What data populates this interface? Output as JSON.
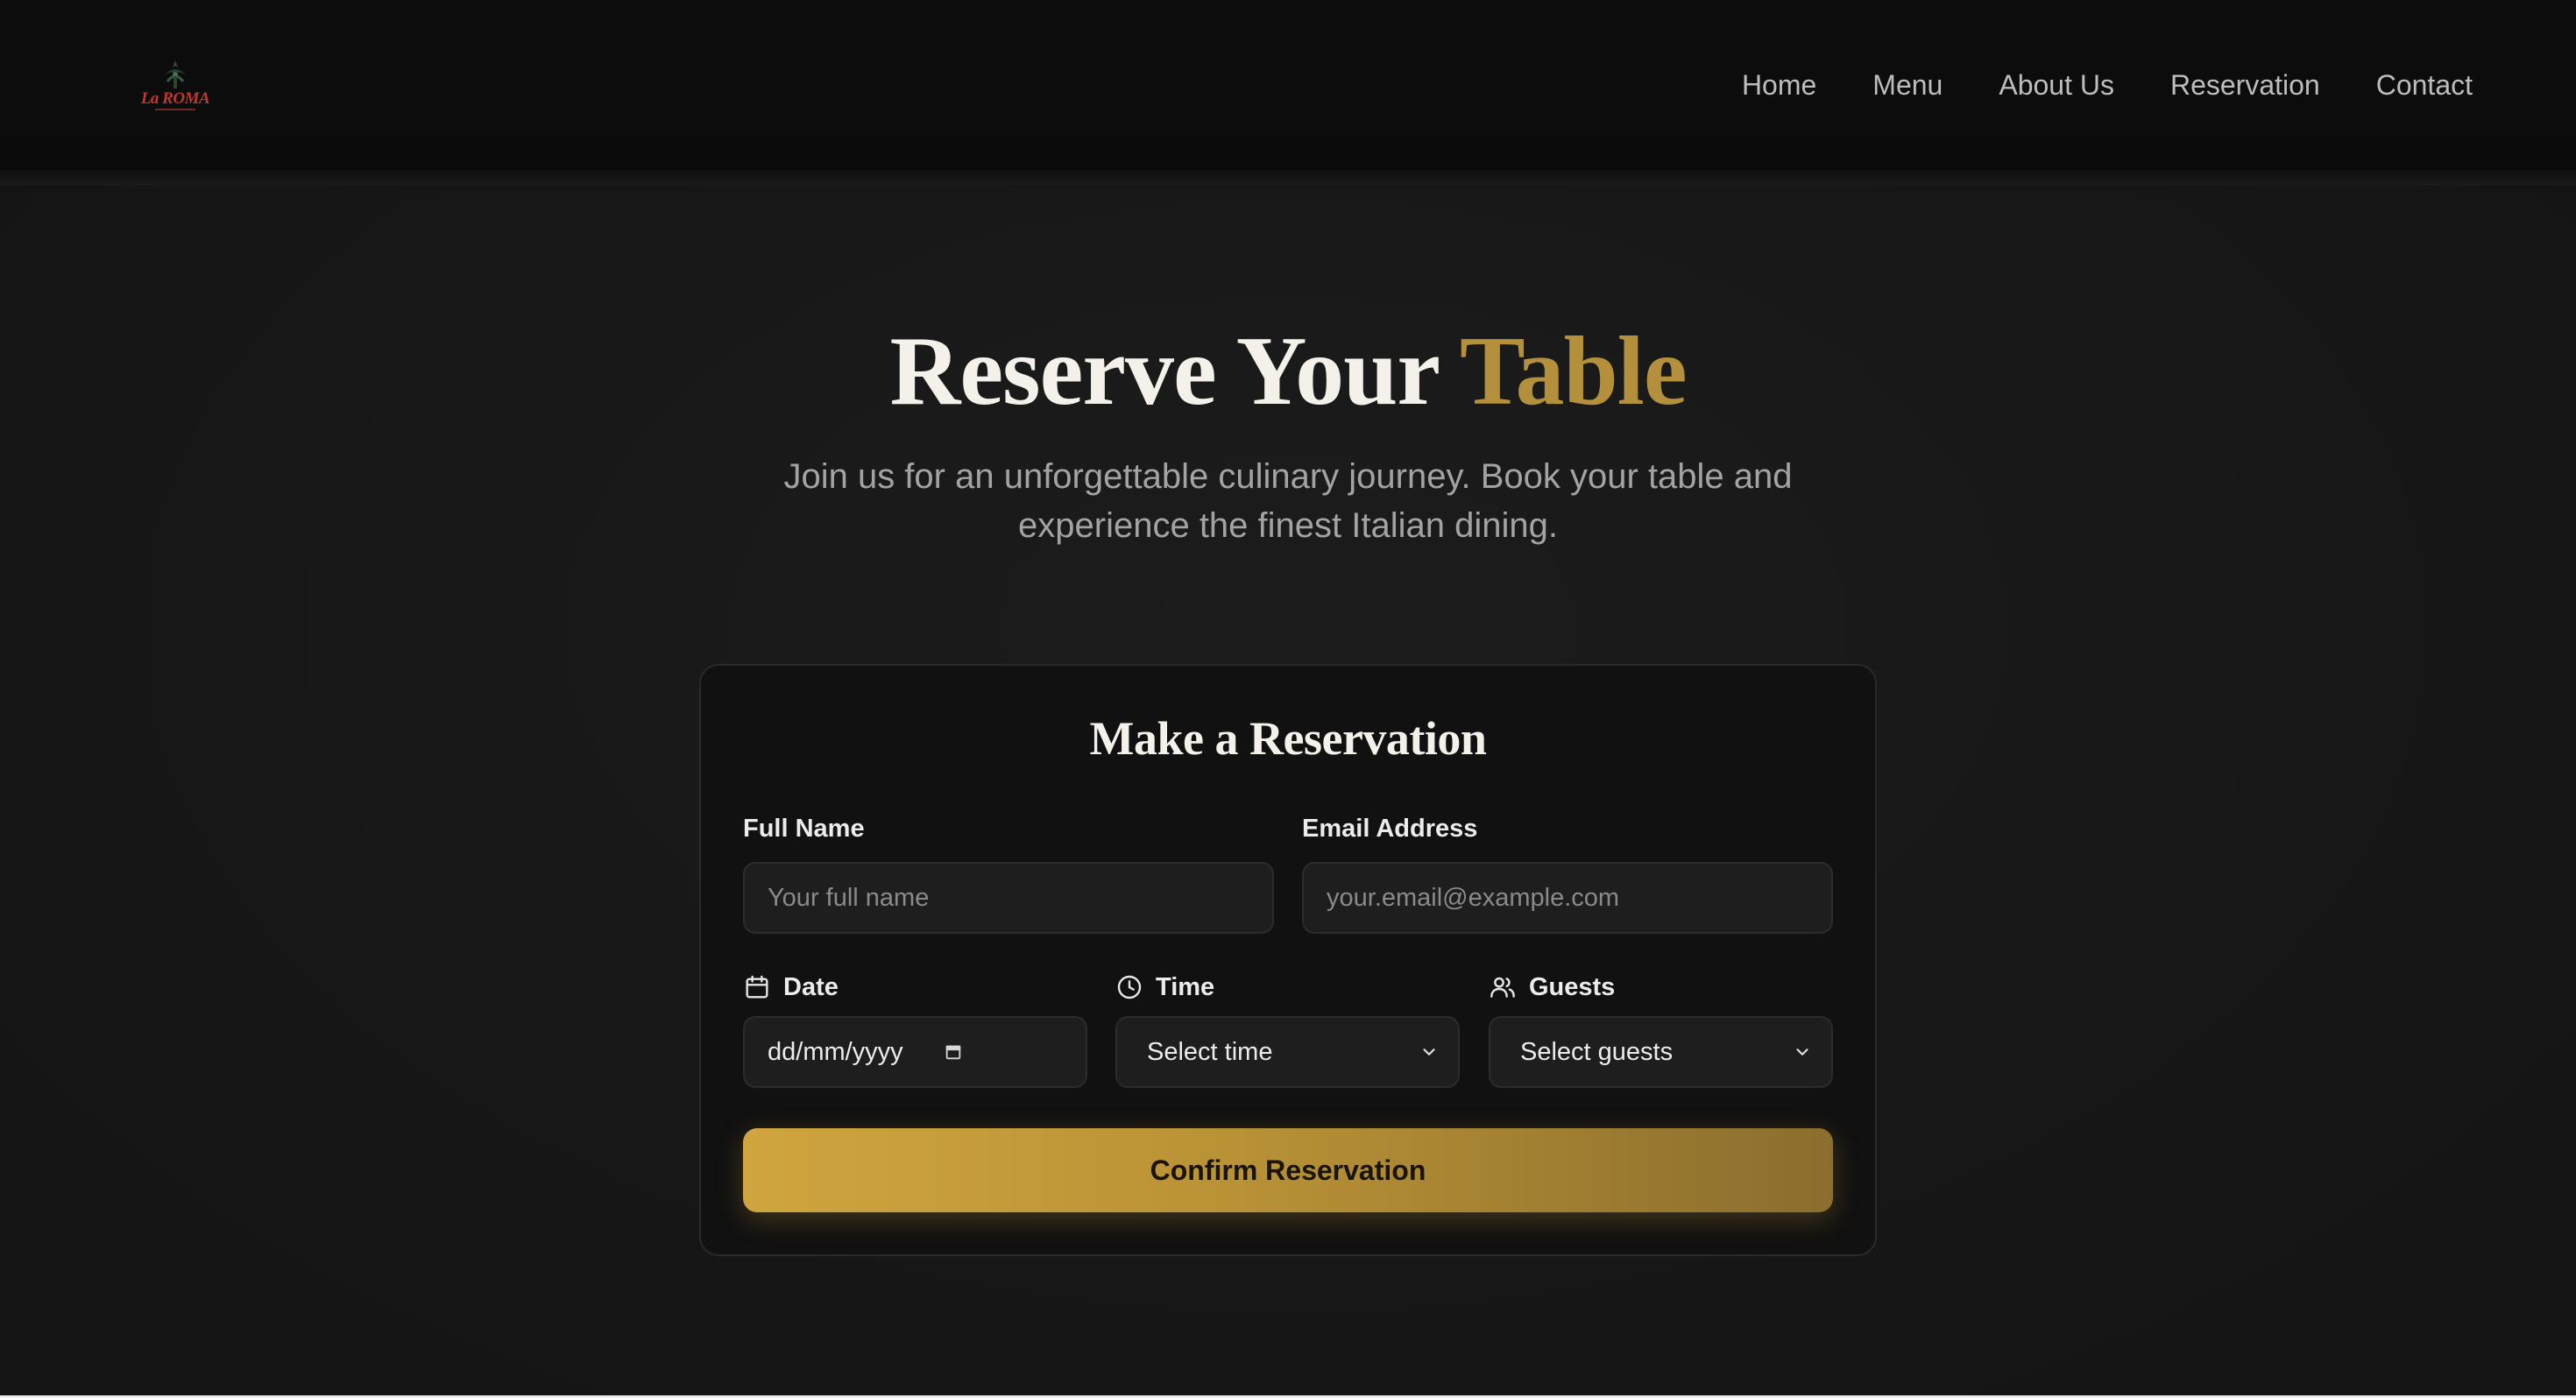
{
  "brand": {
    "logo_text": "La ROMA"
  },
  "nav": {
    "items": [
      {
        "label": "Home"
      },
      {
        "label": "Menu"
      },
      {
        "label": "About Us"
      },
      {
        "label": "Reservation"
      },
      {
        "label": "Contact"
      }
    ]
  },
  "hero": {
    "title_main": "Reserve Your ",
    "title_accent": "Table",
    "subtitle": "Join us for an unforgettable culinary journey. Book your table and experience the finest Italian dining."
  },
  "form": {
    "title": "Make a Reservation",
    "full_name": {
      "label": "Full Name",
      "placeholder": "Your full name"
    },
    "email": {
      "label": "Email Address",
      "placeholder": "your.email@example.com"
    },
    "date": {
      "label": "Date",
      "value": "dd/mm/yyyy",
      "icon": "calendar-icon"
    },
    "time": {
      "label": "Time",
      "value": "Select time",
      "icon": "clock-icon"
    },
    "guests": {
      "label": "Guests",
      "value": "Select guests",
      "icon": "users-icon"
    },
    "submit_label": "Confirm Reservation"
  },
  "colors": {
    "accent": "#b4903c",
    "background": "#171717",
    "button_gradient_start": "#d0a53f",
    "button_gradient_end": "#8b6e2e"
  }
}
